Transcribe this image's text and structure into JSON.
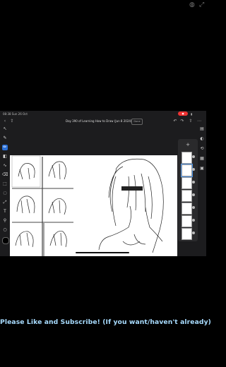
{
  "corner_icons": [
    "user-icon",
    "maximize-icon"
  ],
  "status_bar": {
    "time": "08:38 Sun 26 Oct",
    "recording": "●",
    "battery": "▮"
  },
  "document": {
    "title": "Day 390 of Learning How to Draw (Jun 8 2024)",
    "title_button": "Done"
  },
  "toolbar": {
    "left": [
      "back-icon",
      "export-icon"
    ],
    "right": [
      "undo-icon",
      "redo-icon",
      "share-icon",
      "more-icon"
    ]
  },
  "left_tools": [
    {
      "name": "move-tool",
      "glyph": "↖"
    },
    {
      "name": "brush-tool",
      "glyph": "✎",
      "active": false
    },
    {
      "name": "pencil-tool",
      "glyph": "✏",
      "active": true
    },
    {
      "name": "fill-tool",
      "glyph": "◧"
    },
    {
      "name": "smudge-tool",
      "glyph": "∿"
    },
    {
      "name": "eraser-tool",
      "glyph": "⌫"
    },
    {
      "name": "select-tool",
      "glyph": "⬚"
    },
    {
      "name": "lasso-tool",
      "glyph": "◌"
    },
    {
      "name": "transform-tool",
      "glyph": "⤢"
    },
    {
      "name": "text-tool",
      "glyph": "T"
    },
    {
      "name": "eyedropper-tool",
      "glyph": "⚲"
    },
    {
      "name": "shape-tool",
      "glyph": "○"
    }
  ],
  "layers": {
    "header": "+",
    "count": 7
  },
  "right_rail": [
    "layers-icon",
    "adjust-icon",
    "history-icon",
    "grid-icon",
    "reference-icon"
  ],
  "caption": "Please Like and Subscribe! (If you want/haven't already)"
}
